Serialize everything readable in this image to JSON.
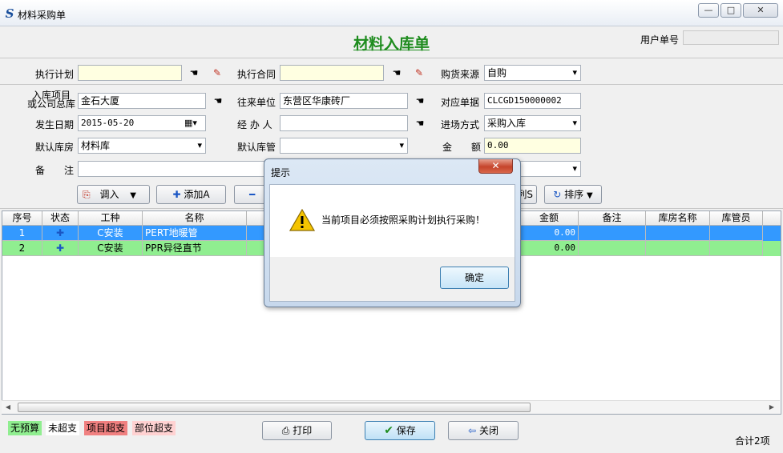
{
  "window": {
    "title": "材料采购单",
    "controls": {
      "minimize": "—",
      "maximize": "□",
      "close": "✕"
    }
  },
  "header": {
    "form_title": "材料入库单",
    "user_no_label": "用户单号",
    "user_no_value": ""
  },
  "row1": {
    "plan_label": "执行计划",
    "plan_value": "",
    "contract_label": "执行合同",
    "contract_value": "",
    "source_label": "购货来源",
    "source_value": "自购"
  },
  "fields": {
    "project_label_1": "入库项目",
    "project_label_2": "或公司总库",
    "project_value": "金石大厦",
    "partner_label": "往来单位",
    "partner_value": "东营区华康砖厂",
    "ref_label": "对应单据",
    "ref_value": "CLCGD150000002",
    "date_label": "发生日期",
    "date_value": "2015-05-20",
    "handler_label": "经 办 人",
    "handler_value": "",
    "entry_label": "进场方式",
    "entry_value": "采购入库",
    "warehouse_label": "默认库房",
    "warehouse_value": "材料库",
    "keeper_label": "默认库管",
    "keeper_value": "",
    "amount_label": "金　　额",
    "amount_value": "0.00",
    "remark_label": "备　　注",
    "remark_value": ""
  },
  "toolbar": {
    "import_label": "调入",
    "add_label": "添加A",
    "hidden_label": "隐藏列S",
    "sort_label": "排序"
  },
  "grid": {
    "headers": [
      "序号",
      "状态",
      "工种",
      "名称",
      "金额",
      "备注",
      "库房名称",
      "库管员"
    ],
    "rows": [
      {
        "no": "1",
        "trade": "C安装",
        "name": "PERT地暖管",
        "amount": "0.00"
      },
      {
        "no": "2",
        "trade": "C安装",
        "name": "PPR异径直节",
        "amount": "0.00"
      }
    ]
  },
  "legend": [
    "无预算",
    "未超支",
    "项目超支",
    "部位超支"
  ],
  "footer": {
    "print_label": "打印",
    "save_label": "保存",
    "close_label": "关闭",
    "total": "合计2项"
  },
  "dialog": {
    "title": "提示",
    "message": "当前项目必须按照采购计划执行采购！",
    "ok_label": "确定",
    "close_glyph": "✕"
  },
  "colors": {
    "row_selected": "#3399ff",
    "row_green": "#90ee90",
    "legend_green": "#90ee90",
    "legend_red": "#f08080",
    "legend_pink": "#ffd2d2",
    "title_green": "#1e8c1e"
  }
}
